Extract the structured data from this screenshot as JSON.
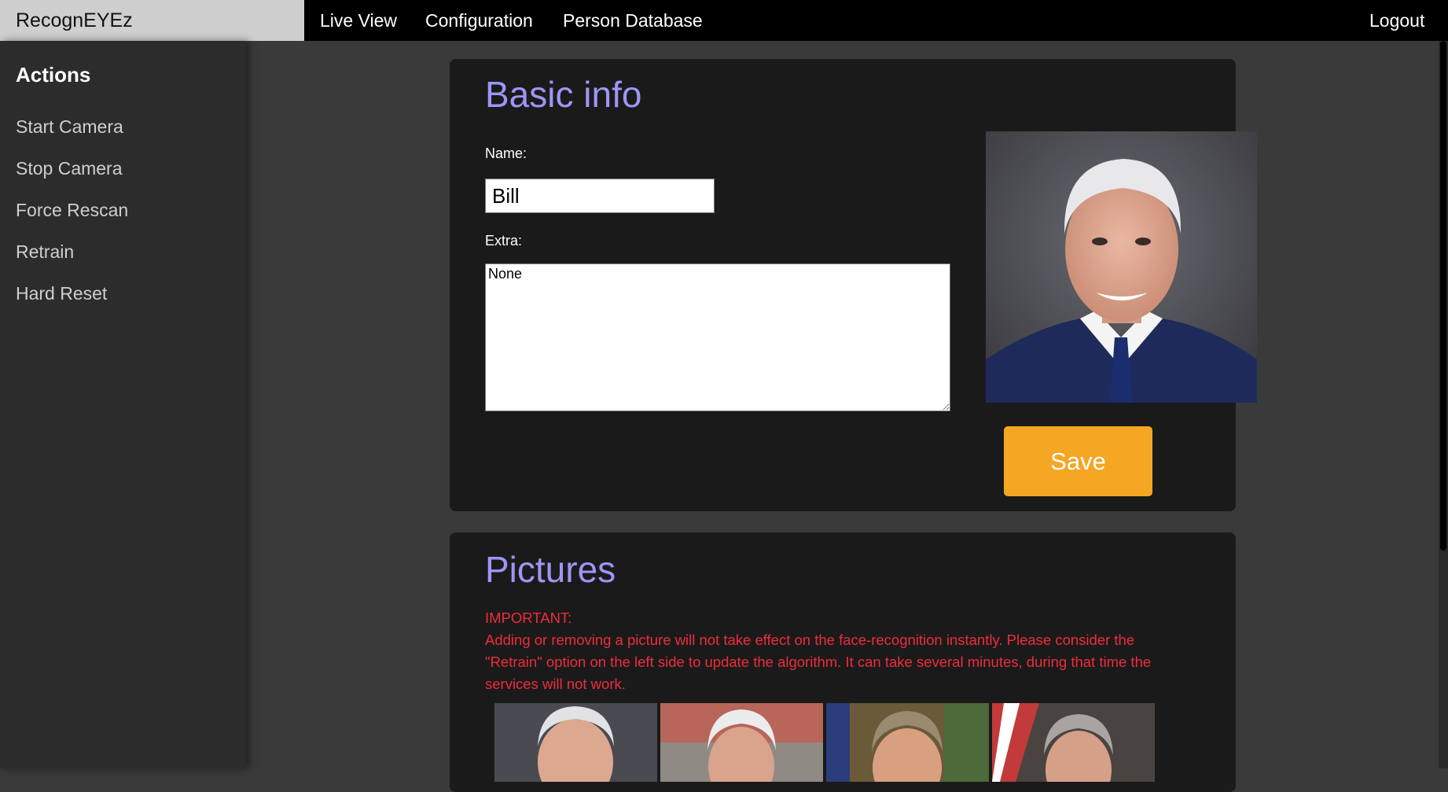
{
  "app": {
    "brand": "RecognEYEz"
  },
  "nav": {
    "links": [
      "Live View",
      "Configuration",
      "Person Database"
    ],
    "logout": "Logout"
  },
  "sidebar": {
    "title": "Actions",
    "items": [
      "Start Camera",
      "Stop Camera",
      "Force Rescan",
      "Retrain",
      "Hard Reset"
    ]
  },
  "basic_info": {
    "title": "Basic info",
    "name_label": "Name:",
    "name_value": "Bill",
    "extra_label": "Extra:",
    "extra_value": "None",
    "save_label": "Save"
  },
  "pictures": {
    "title": "Pictures",
    "notice_heading": "IMPORTANT:",
    "notice_body": "Adding or removing a picture will not take effect on the face-recognition instantly. Please consider the \"Retrain\" option on the left side to update the algorithm. It can take several minutes, during that time the services will not work."
  },
  "colors": {
    "accent_title": "#9d96f5",
    "save_button": "#f5a623",
    "notice_text": "#ee2d3a",
    "card_bg": "#1a1a1a",
    "page_bg": "#3a3a3a"
  }
}
